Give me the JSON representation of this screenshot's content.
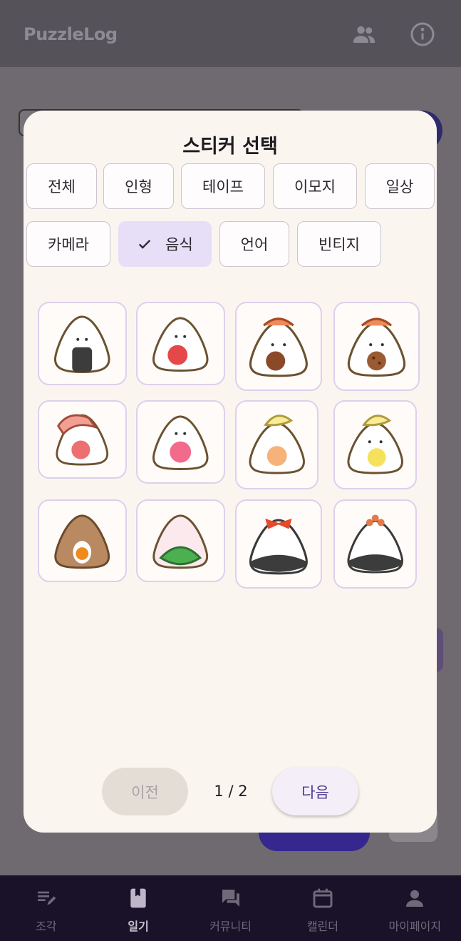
{
  "app": {
    "logo_text": "PuzzleLog"
  },
  "header_icons": [
    "people-icon",
    "info-icon"
  ],
  "modal": {
    "title": "스티커 선택",
    "categories": [
      {
        "label": "전체",
        "selected": false
      },
      {
        "label": "인형",
        "selected": false
      },
      {
        "label": "테이프",
        "selected": false
      },
      {
        "label": "이모지",
        "selected": false
      },
      {
        "label": "일상",
        "selected": false
      },
      {
        "label": "카메라",
        "selected": false
      },
      {
        "label": "음식",
        "selected": true
      },
      {
        "label": "언어",
        "selected": false
      },
      {
        "label": "빈티지",
        "selected": false
      }
    ],
    "stickers": [
      "onigiri-nori-sticker",
      "onigiri-umeboshi-sticker",
      "onigiri-shrimp-fried-sticker",
      "onigiri-shrimp-cookie-sticker",
      "onigiri-ham-sticker",
      "onigiri-pink-sticker",
      "onigiri-hat-egg-sticker",
      "onigiri-chick-sticker",
      "onigiri-brown-egg-sticker",
      "onigiri-shiso-sticker",
      "onigiri-bow-nori-sticker",
      "onigiri-flower-nori-sticker"
    ],
    "pager": {
      "prev_label": "이전",
      "page_text": "1 / 2",
      "next_label": "다음"
    }
  },
  "bottom_nav": [
    {
      "label": "조각",
      "icon": "notes-edit-icon",
      "active": false
    },
    {
      "label": "일기",
      "icon": "book-icon",
      "active": true
    },
    {
      "label": "커뮤니티",
      "icon": "forum-icon",
      "active": false
    },
    {
      "label": "캘린더",
      "icon": "calendar-icon",
      "active": false
    },
    {
      "label": "마이페이지",
      "icon": "person-icon",
      "active": false
    }
  ],
  "colors": {
    "scrim": "#6e6a70",
    "modal_bg": "#fbf5f0",
    "chip_selected": "#e7def7",
    "nav_bg": "#1a1228",
    "accent": "#35278d"
  }
}
